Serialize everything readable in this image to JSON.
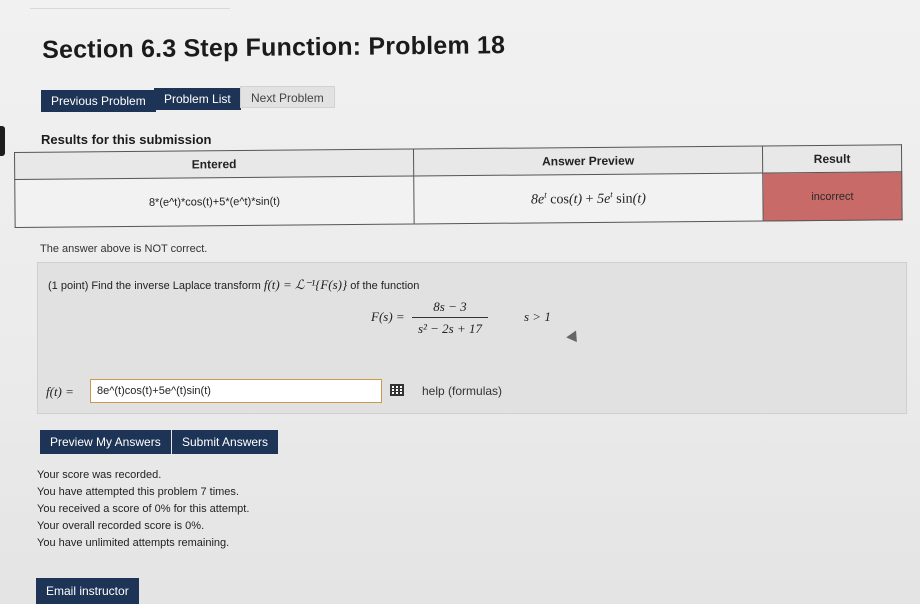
{
  "page": {
    "title": "Section 6.3 Step Function: Problem 18",
    "nav": {
      "previous": "Previous Problem",
      "list": "Problem List",
      "next": "Next Problem"
    },
    "results_heading": "Results for this submission"
  },
  "results_table": {
    "headers": [
      "Entered",
      "Answer Preview",
      "Result"
    ],
    "entered": "8*(e^t)*cos(t)+5*(e^t)*sin(t)",
    "preview": {
      "coef1": "8e",
      "exp1": "t",
      "func1": "cos",
      "arg1": "(t)",
      "plus": " + ",
      "coef2": "5e",
      "exp2": "t",
      "func2": "sin",
      "arg2": "(t)"
    },
    "result": "incorrect",
    "result_color": "#c86a67"
  },
  "feedback": "The answer above is NOT correct.",
  "problem": {
    "points": "(1 point)",
    "prompt_start": "Find the inverse Laplace transform",
    "prompt_math": "f(t) = ℒ⁻¹{F(s)}",
    "prompt_end": "of the function",
    "lhs": "F(s) =",
    "numerator": "8s − 3",
    "denominator": "s² − 2s + 17",
    "condition": "s > 1",
    "answer_label": "f(t) =",
    "answer_value": "8e^(t)cos(t)+5e^(t)sin(t)",
    "help_text": "help (formulas)"
  },
  "actions": {
    "preview": "Preview My Answers",
    "submit": "Submit Answers"
  },
  "score_lines": [
    "Your score was recorded.",
    "You have attempted this problem 7 times.",
    "You received a score of 0% for this attempt.",
    "Your overall recorded score is 0%.",
    "You have unlimited attempts remaining."
  ],
  "email_button": "Email instructor",
  "colors": {
    "primary_button": "#1e3456",
    "incorrect": "#c86a67",
    "input_border": "#c89a4a"
  }
}
